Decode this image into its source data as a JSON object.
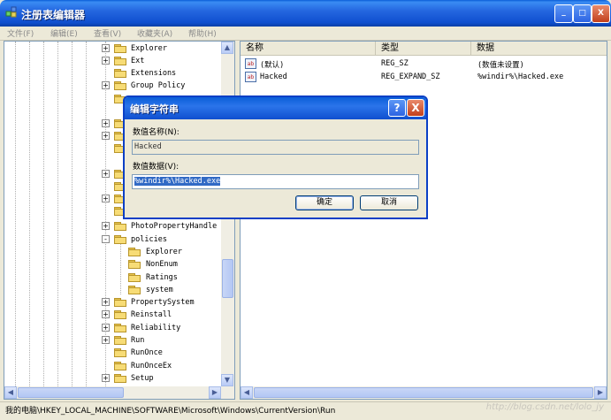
{
  "window": {
    "title": "注册表编辑器",
    "minimize_glyph": "_",
    "maximize_glyph": "□",
    "close_glyph": "X"
  },
  "menu": [
    "文件(F)",
    "编辑(E)",
    "查看(V)",
    "收藏夹(A)",
    "帮助(H)"
  ],
  "tree": {
    "items": [
      {
        "label": "Explorer",
        "expander": "+"
      },
      {
        "label": "Ext",
        "expander": "+"
      },
      {
        "label": "Extensions",
        "expander": ""
      },
      {
        "label": "Group Policy",
        "expander": "+"
      },
      {
        "label": "PhotoPropertyHandle",
        "expander": "+"
      },
      {
        "label": "policies",
        "expander": "-"
      },
      {
        "label": "Explorer",
        "expander": ""
      },
      {
        "label": "NonEnum",
        "expander": ""
      },
      {
        "label": "Ratings",
        "expander": ""
      },
      {
        "label": "system",
        "expander": ""
      },
      {
        "label": "PropertySystem",
        "expander": "+"
      },
      {
        "label": "Reinstall",
        "expander": "+"
      },
      {
        "label": "Reliability",
        "expander": "+"
      },
      {
        "label": "Run",
        "expander": "+"
      },
      {
        "label": "RunOnce",
        "expander": ""
      },
      {
        "label": "RunOnceEx",
        "expander": ""
      },
      {
        "label": "Setup",
        "expander": "+"
      }
    ]
  },
  "list": {
    "headers": [
      "名称",
      "类型",
      "数据"
    ],
    "rows": [
      {
        "icon": "ab",
        "name": "(默认)",
        "type": "REG_SZ",
        "data": "(数值未设置)"
      },
      {
        "icon": "ab",
        "name": "Hacked",
        "type": "REG_EXPAND_SZ",
        "data": "%windir%\\Hacked.exe"
      }
    ]
  },
  "dialog": {
    "title": "编辑字符串",
    "help_glyph": "?",
    "close_glyph": "X",
    "name_label": "数值名称(N):",
    "name_value": "Hacked",
    "data_label": "数值数据(V):",
    "data_value": "%windir%\\Hacked.exe",
    "ok_label": "确定",
    "cancel_label": "取消"
  },
  "status": {
    "path": "我的电脑\\HKEY_LOCAL_MACHINE\\SOFTWARE\\Microsoft\\Windows\\CurrentVersion\\Run",
    "watermark": "http://blog.csdn.net/lolo_jy"
  },
  "colors": {
    "titlebar": "#0a5fd8",
    "selection": "#316ac5",
    "close_button": "#c2401c"
  }
}
